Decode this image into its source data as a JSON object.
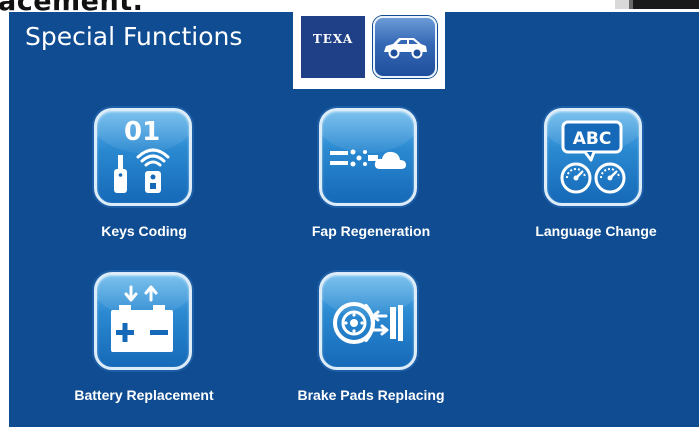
{
  "page": {
    "cropped_heading": "acement."
  },
  "screen": {
    "title": "Special Functions",
    "brand_logo_text": "TEXA",
    "icons": {
      "brand": "texa-logo",
      "vehicle": "car-icon"
    }
  },
  "functions": [
    {
      "label": "Keys Coding",
      "icon": "key-fob-wireless-icon",
      "badge_text": "01"
    },
    {
      "label": "Fap Regeneration",
      "icon": "particulate-filter-icon"
    },
    {
      "label": "Language Change",
      "icon": "language-dashboard-icon",
      "badge_text": "ABC"
    },
    {
      "label": "Battery Replacement",
      "icon": "battery-icon"
    },
    {
      "label": "Brake Pads Replacing",
      "icon": "brake-pads-icon"
    }
  ],
  "colors": {
    "screen_background": "#0f4c91",
    "tile_top": "#5fb4ea",
    "tile_bottom": "#1669b8",
    "label_text": "#ffffff"
  }
}
